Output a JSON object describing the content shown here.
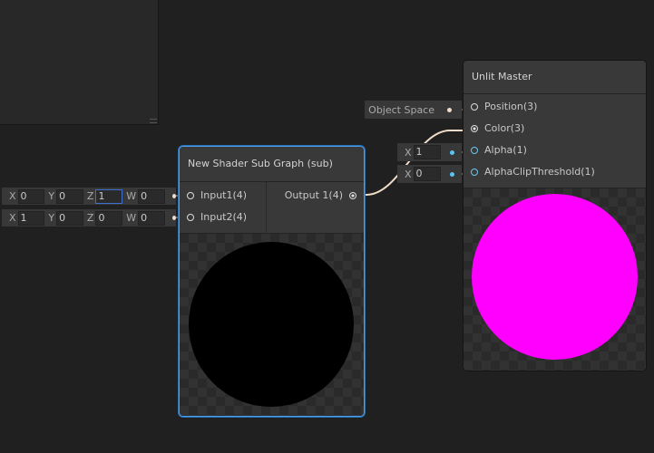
{
  "subgraph_node": {
    "title": "New Shader Sub Graph (sub)",
    "inputs": [
      "Input1(4)",
      "Input2(4)"
    ],
    "output": "Output 1(4)"
  },
  "input1_vector": {
    "labels": [
      "X",
      "Y",
      "Z",
      "W"
    ],
    "values": [
      "0",
      "0",
      "1",
      "0"
    ]
  },
  "input2_vector": {
    "labels": [
      "X",
      "Y",
      "Z",
      "W"
    ],
    "values": [
      "1",
      "0",
      "0",
      "0"
    ]
  },
  "master_node": {
    "title": "Unlit Master",
    "ports": [
      "Position(3)",
      "Color(3)",
      "Alpha(1)",
      "AlphaClipThreshold(1)"
    ]
  },
  "position_input": {
    "label": "Object Space"
  },
  "alpha_input": {
    "label": "X",
    "value": "1"
  },
  "clip_input": {
    "label": "X",
    "value": "0"
  },
  "colors": {
    "selection": "#4a9ff0",
    "preview_master": "#ff00ff",
    "preview_sub": "#000000",
    "wire": "#f0dcc8",
    "float_port": "#5ac4f2"
  }
}
